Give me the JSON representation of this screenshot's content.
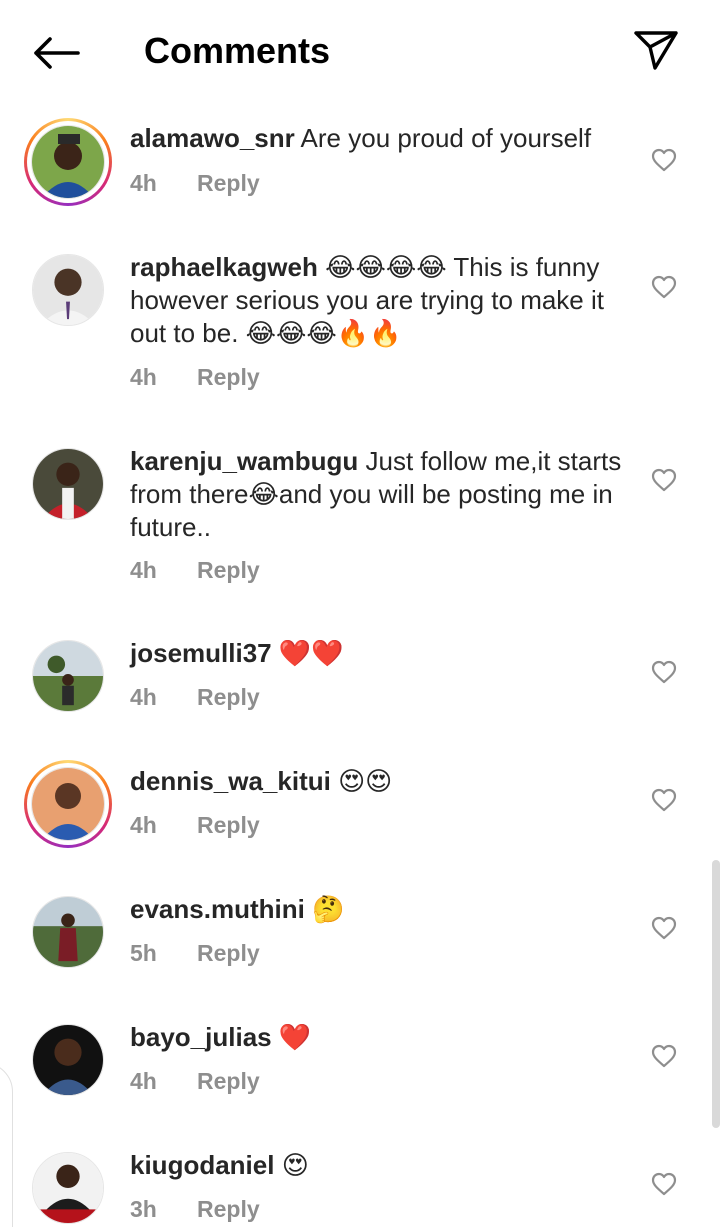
{
  "header": {
    "title": "Comments",
    "back_icon": "arrow-left-icon",
    "send_icon": "paper-plane-icon"
  },
  "colors": {
    "text": "#262626",
    "meta": "#8e8e8e",
    "story_ring": [
      "#feda75",
      "#fa7e1e",
      "#d62976",
      "#962fbf"
    ]
  },
  "comments": [
    {
      "username": "alamawo_snr",
      "text": "Are you proud of yourself",
      "time": "4h",
      "reply": "Reply",
      "has_story_ring": true
    },
    {
      "username": "raphaelkagweh",
      "text": "😂😂😂😂 This is funny however serious you are trying to make it out to be. 😂😂😂🔥🔥",
      "time": "4h",
      "reply": "Reply",
      "has_story_ring": false
    },
    {
      "username": "karenju_wambugu",
      "text": "Just follow me,it starts from there😂and you will be posting me in future..",
      "time": "4h",
      "reply": "Reply",
      "has_story_ring": false
    },
    {
      "username": "josemulli37",
      "text": "❤️❤️",
      "time": "4h",
      "reply": "Reply",
      "has_story_ring": false
    },
    {
      "username": "dennis_wa_kitui",
      "text": "😍😍",
      "time": "4h",
      "reply": "Reply",
      "has_story_ring": true
    },
    {
      "username": "evans.muthini",
      "text": "🤔",
      "time": "5h",
      "reply": "Reply",
      "has_story_ring": false
    },
    {
      "username": "bayo_julias",
      "text": "❤️",
      "time": "4h",
      "reply": "Reply",
      "has_story_ring": false
    },
    {
      "username": "kiugodaniel",
      "text": "😍",
      "time": "3h",
      "reply": "Reply",
      "has_story_ring": false
    }
  ]
}
